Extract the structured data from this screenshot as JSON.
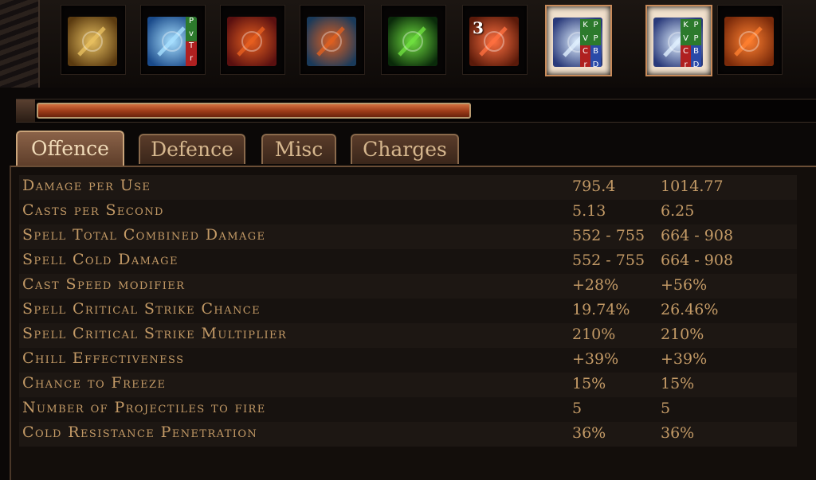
{
  "skills": [
    {
      "name": "sword-skill-icon",
      "colors": [
        "#5a3a10",
        "#e8c060"
      ]
    },
    {
      "name": "ice-shards-skill-icon",
      "colors": [
        "#1a4a8a",
        "#a8e0ff"
      ],
      "links": [
        {
          "t": "P",
          "c": "#2c7a2c"
        },
        {
          "t": "v",
          "c": "#2c7a2c"
        },
        {
          "t": "T",
          "c": "#b02020"
        },
        {
          "t": "r",
          "c": "#b02020"
        }
      ]
    },
    {
      "name": "blood-rage-skill-icon",
      "colors": [
        "#5a1010",
        "#e86020"
      ]
    },
    {
      "name": "fist-aura-skill-icon",
      "colors": [
        "#1a3a5a",
        "#e06020"
      ]
    },
    {
      "name": "green-arrow-skill-icon",
      "colors": [
        "#0a2a0a",
        "#70e040"
      ]
    },
    {
      "name": "running-man-skill-icon",
      "colors": [
        "#5a1a0a",
        "#ff7040"
      ],
      "num": "3"
    },
    {
      "name": "frost-orb-gem-icon",
      "colors": [
        "#2a3a7a",
        "#e0f0ff"
      ],
      "gem": [
        "K",
        "P",
        "V",
        "P",
        "C",
        "B",
        "r",
        "D"
      ]
    },
    {
      "name": "frost-orb-gem-icon-2",
      "colors": [
        "#2a3a7a",
        "#e0f0ff"
      ],
      "gem": [
        "K",
        "P",
        "V",
        "P",
        "C",
        "B",
        "r",
        "D"
      ]
    },
    {
      "name": "golem-skill-icon",
      "colors": [
        "#7a2a0a",
        "#ff8030"
      ]
    }
  ],
  "progress": {
    "fill": 0.56
  },
  "tabs": [
    {
      "label": "Offence",
      "active": true
    },
    {
      "label": "Defence"
    },
    {
      "label": "Misc"
    },
    {
      "label": "Charges"
    }
  ],
  "stats": [
    {
      "label": "Damage per Use",
      "v1": "795.4",
      "v2": "1014.77"
    },
    {
      "label": "Casts per Second",
      "v1": "5.13",
      "v2": "6.25"
    },
    {
      "label": "Spell Total Combined Damage",
      "v1": "552 - 755",
      "v2": "664 - 908"
    },
    {
      "label": "Spell Cold Damage",
      "v1": "552 - 755",
      "v2": "664 - 908"
    },
    {
      "label": "Cast Speed modifier",
      "v1": "+28%",
      "v2": "+56%"
    },
    {
      "label": "Spell Critical Strike Chance",
      "v1": "19.74%",
      "v2": "26.46%"
    },
    {
      "label": "Spell Critical Strike Multiplier",
      "v1": "210%",
      "v2": "210%"
    },
    {
      "label": "Chill Effectiveness",
      "v1": "+39%",
      "v2": "+39%"
    },
    {
      "label": "Chance to Freeze",
      "v1": "15%",
      "v2": "15%"
    },
    {
      "label": "Number of Projectiles to fire",
      "v1": "5",
      "v2": "5"
    },
    {
      "label": "Cold Resistance Penetration",
      "v1": "36%",
      "v2": "36%"
    }
  ]
}
